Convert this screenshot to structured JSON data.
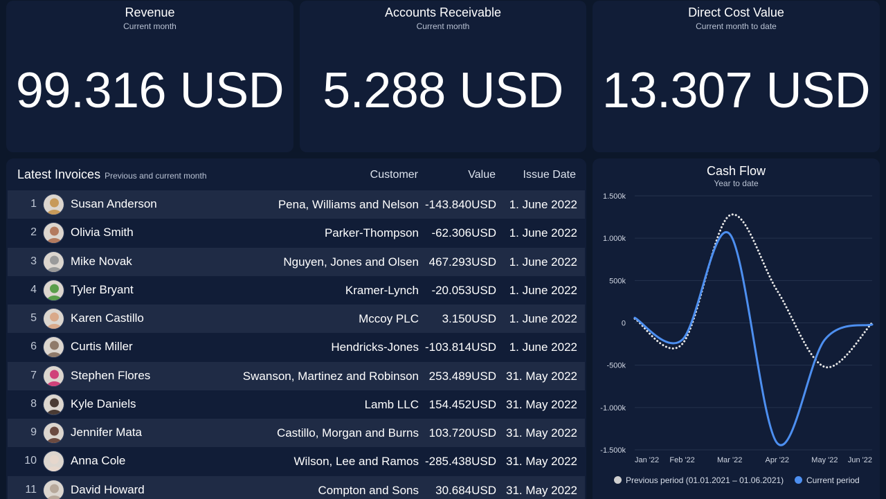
{
  "kpis": [
    {
      "title": "Revenue",
      "subtitle": "Current month",
      "value": "99.316 USD"
    },
    {
      "title": "Accounts Receivable",
      "subtitle": "Current month",
      "value": "5.288 USD"
    },
    {
      "title": "Direct Cost Value",
      "subtitle": "Current month to date",
      "value": "13.307 USD"
    }
  ],
  "invoices": {
    "title": "Latest Invoices",
    "subtitle": "Previous and current month",
    "columns": {
      "customer": "Customer",
      "value": "Value",
      "issue_date": "Issue Date"
    },
    "rows": [
      {
        "index": "1",
        "name": "Susan Anderson",
        "customer": "Pena, Williams and Nelson",
        "value": "-143.840USD",
        "date": "1. June 2022",
        "avatar_color": "#c79a5a"
      },
      {
        "index": "2",
        "name": "Olivia Smith",
        "customer": "Parker-Thompson",
        "value": "-62.306USD",
        "date": "1. June 2022",
        "avatar_color": "#b37a5e"
      },
      {
        "index": "3",
        "name": "Mike Novak",
        "customer": "Nguyen, Jones and Olsen",
        "value": "467.293USD",
        "date": "1. June 2022",
        "avatar_color": "#9a9a9a"
      },
      {
        "index": "4",
        "name": "Tyler Bryant",
        "customer": "Kramer-Lynch",
        "value": "-20.053USD",
        "date": "1. June 2022",
        "avatar_color": "#5a9e4b"
      },
      {
        "index": "5",
        "name": "Karen Castillo",
        "customer": "Mccoy PLC",
        "value": "3.150USD",
        "date": "1. June 2022",
        "avatar_color": "#d9a98a"
      },
      {
        "index": "6",
        "name": "Curtis Miller",
        "customer": "Hendricks-Jones",
        "value": "-103.814USD",
        "date": "1. June 2022",
        "avatar_color": "#8f7a6a"
      },
      {
        "index": "7",
        "name": "Stephen Flores",
        "customer": "Swanson, Martinez and Robinson",
        "value": "253.489USD",
        "date": "31. May 2022",
        "avatar_color": "#d0427a"
      },
      {
        "index": "8",
        "name": "Kyle Daniels",
        "customer": "Lamb LLC",
        "value": "154.452USD",
        "date": "31. May 2022",
        "avatar_color": "#4a3b34"
      },
      {
        "index": "9",
        "name": "Jennifer Mata",
        "customer": "Castillo, Morgan and Burns",
        "value": "103.720USD",
        "date": "31. May 2022",
        "avatar_color": "#6b4a40"
      },
      {
        "index": "10",
        "name": "Anna Cole",
        "customer": "Wilson, Lee and Ramos",
        "value": "-285.438USD",
        "date": "31. May 2022",
        "avatar_color": "#e6d7cc"
      },
      {
        "index": "11",
        "name": "David Howard",
        "customer": "Compton and Sons",
        "value": "30.684USD",
        "date": "31. May 2022",
        "avatar_color": "#b7a89a"
      }
    ]
  },
  "cashflow": {
    "title": "Cash Flow",
    "subtitle": "Year to date"
  },
  "chart_data": {
    "type": "line",
    "title": "Cash Flow",
    "subtitle": "Year to date",
    "x": [
      "Jan '22",
      "Feb '22",
      "Mar '22",
      "Apr '22",
      "May '22",
      "Jun '22"
    ],
    "y_ticks": [
      "1.500k",
      "1.000k",
      "500k",
      "0",
      "-500k",
      "-1.000k",
      "-1.500k"
    ],
    "ylim": [
      -1500000,
      1500000
    ],
    "grid": true,
    "legend_position": "bottom",
    "series": [
      {
        "name": "Previous period (01.01.2021 – 01.06.2021)",
        "style": "dotted",
        "color": "#e6e6e6",
        "legend_color": "#cfcfcf",
        "values": [
          50000,
          -250000,
          1270000,
          380000,
          -520000,
          0
        ]
      },
      {
        "name": "Current period",
        "style": "solid",
        "color": "#4d8ff0",
        "values": [
          60000,
          -200000,
          1050000,
          -1420000,
          -200000,
          -20000
        ]
      }
    ]
  }
}
